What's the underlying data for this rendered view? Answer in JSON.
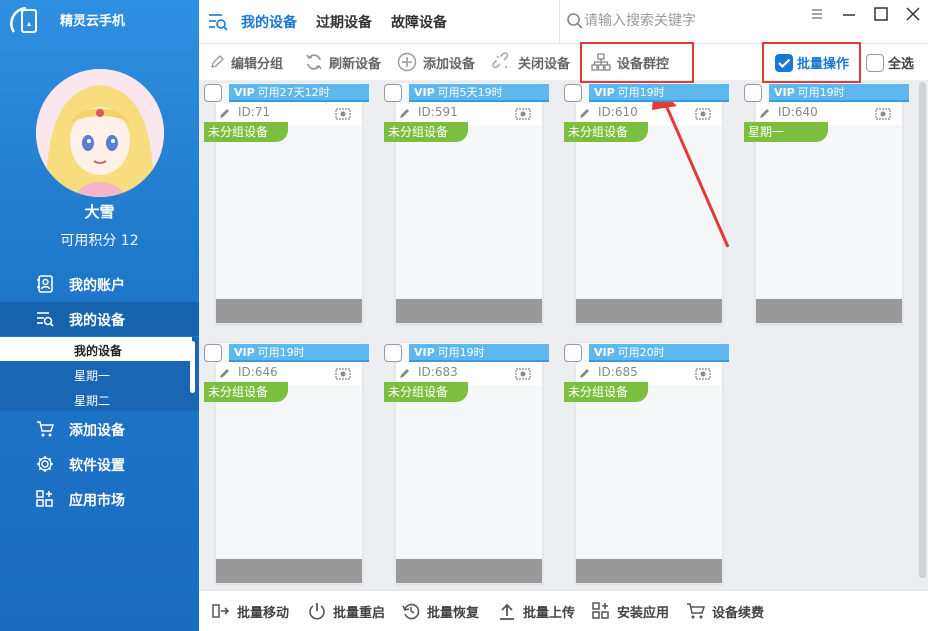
{
  "app": {
    "title": "精灵云手机"
  },
  "user": {
    "name": "大雪",
    "points_label": "可用积分 12"
  },
  "sidebar": {
    "nav": [
      {
        "label": "我的账户",
        "icon": "account-icon"
      },
      {
        "label": "我的设备",
        "icon": "device-list-icon"
      },
      {
        "label": "添加设备",
        "icon": "cart-icon"
      },
      {
        "label": "软件设置",
        "icon": "gear-icon"
      },
      {
        "label": "应用市场",
        "icon": "apps-icon"
      }
    ],
    "subitems": [
      {
        "label": "我的设备"
      },
      {
        "label": "星期一"
      },
      {
        "label": "星期二"
      }
    ]
  },
  "tabs": [
    {
      "label": "我的设备"
    },
    {
      "label": "过期设备"
    },
    {
      "label": "故障设备"
    }
  ],
  "search": {
    "placeholder": "请输入搜索关键字"
  },
  "toolbar": {
    "edit_group": "编辑分组",
    "refresh": "刷新设备",
    "add": "添加设备",
    "close": "关闭设备",
    "group_control": "设备群控",
    "batch_op": "批量操作",
    "select_all": "全选"
  },
  "devices": [
    {
      "vip": "VIP",
      "status": "可用27天12时",
      "id": "ID:71",
      "group": "未分组设备"
    },
    {
      "vip": "VIP",
      "status": "可用5天19时",
      "id": "ID:591",
      "group": "未分组设备"
    },
    {
      "vip": "VIP",
      "status": "可用19时",
      "id": "ID:610",
      "group": "未分组设备"
    },
    {
      "vip": "VIP",
      "status": "可用19时",
      "id": "ID:640",
      "group": "星期一"
    },
    {
      "vip": "VIP",
      "status": "可用19时",
      "id": "ID:646",
      "group": "未分组设备"
    },
    {
      "vip": "VIP",
      "status": "可用19时",
      "id": "ID:683",
      "group": "未分组设备"
    },
    {
      "vip": "VIP",
      "status": "可用20时",
      "id": "ID:685",
      "group": "未分组设备"
    }
  ],
  "bottombar": {
    "move": "批量移动",
    "restart": "批量重启",
    "restore": "批量恢复",
    "upload": "批量上传",
    "install": "安装应用",
    "renew": "设备续费"
  },
  "colors": {
    "sidebar": "#2584d8",
    "accent": "#1a78d4",
    "vip_tag": "#5cb8ef",
    "group_tag": "#7cbf3f",
    "highlight": "#e53935"
  }
}
